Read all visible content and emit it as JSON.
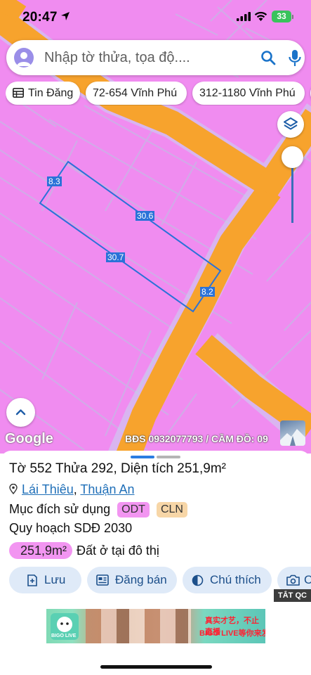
{
  "status_bar": {
    "time": "20:47",
    "battery": "33"
  },
  "search": {
    "placeholder": "Nhập tờ thửa, tọa độ...."
  },
  "chips": [
    {
      "label": "Tin Đăng"
    },
    {
      "label": "72-654 Vĩnh Phú"
    },
    {
      "label": "312-1180 Vĩnh Phú"
    }
  ],
  "map": {
    "edge_labels": [
      "8.3",
      "30.6",
      "30.7",
      "8.2"
    ],
    "google_label": "Google",
    "attribution": "BĐS 0932077793 / CẦM ĐỒ: 09",
    "colors": {
      "land": "#f08cf0",
      "road": "#f7a32d",
      "boundary": "#2a72d8"
    }
  },
  "parcel": {
    "to_label": "Tờ",
    "to_value": "552",
    "thua_label": "Thửa",
    "thua_value": "292",
    "area_label": "Diện tích",
    "area_value": "251,9m²",
    "ward": "Lái Thiêu",
    "district": "Thuận An",
    "purpose_label": "Mục đích sử dụng",
    "purpose_tags": [
      "ODT",
      "CLN"
    ],
    "plan_label": "Quy hoạch SDĐ 2030",
    "plan_area": "251,9m²",
    "plan_desc": "Đất ở tại đô thị"
  },
  "actions": [
    {
      "label": "Lưu",
      "icon": "bookmark-plus-icon"
    },
    {
      "label": "Đăng bán",
      "icon": "newspaper-icon"
    },
    {
      "label": "Chú thích",
      "icon": "contrast-icon"
    },
    {
      "label": "Cá",
      "icon": "camera-icon"
    }
  ],
  "ad": {
    "close_label": "TẮT QC",
    "brand": "BIGO LIVE",
    "text_top": "真实才艺，不止直播",
    "text_bottom": "BIGO LIVE等你来发现"
  }
}
